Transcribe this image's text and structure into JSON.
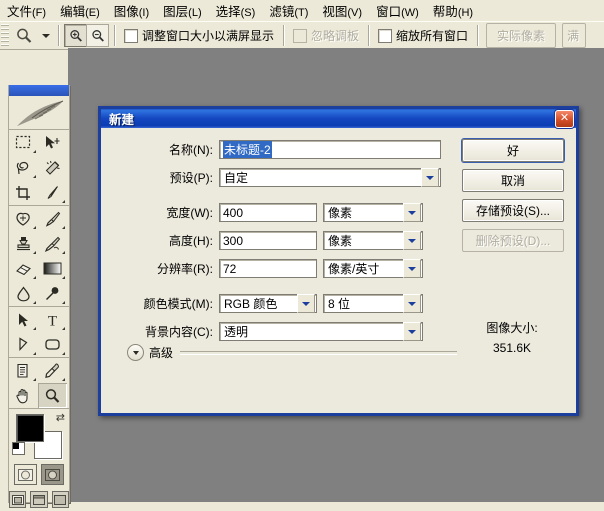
{
  "menubar": {
    "items": [
      {
        "label": "文件",
        "mnemonic": "(F)"
      },
      {
        "label": "编辑",
        "mnemonic": "(E)"
      },
      {
        "label": "图像",
        "mnemonic": "(I)"
      },
      {
        "label": "图层",
        "mnemonic": "(L)"
      },
      {
        "label": "选择",
        "mnemonic": "(S)"
      },
      {
        "label": "滤镜",
        "mnemonic": "(T)"
      },
      {
        "label": "视图",
        "mnemonic": "(V)"
      },
      {
        "label": "窗口",
        "mnemonic": "(W)"
      },
      {
        "label": "帮助",
        "mnemonic": "(H)"
      }
    ]
  },
  "options_bar": {
    "tool_icon": "zoom-tool-icon",
    "preset_dropdown_icon": "chevron-down-icon",
    "zoom_in_icon": "zoom-in-icon",
    "zoom_out_icon": "zoom-out-icon",
    "fit_window_checkbox": {
      "label": "调整窗口大小以满屏显示",
      "checked": false
    },
    "ignore_palettes_checkbox": {
      "label": "忽略调板",
      "checked": false,
      "disabled": true
    },
    "zoom_all_windows_checkbox": {
      "label": "缩放所有窗口",
      "checked": false
    },
    "actual_pixels_button": {
      "label": "实际像素",
      "disabled": true
    },
    "fit_screen_button": {
      "label": "满",
      "disabled": true
    }
  },
  "toolbox": {
    "logo_icon": "feather-logo-icon",
    "tools": [
      [
        {
          "name": "marquee-tool",
          "icon": "rect-marquee-icon",
          "selected": false,
          "has_flyout": true
        },
        {
          "name": "move-tool",
          "icon": "move-arrow-icon",
          "selected": false,
          "has_flyout": false
        },
        {
          "name": "lasso-tool",
          "icon": "lasso-icon",
          "selected": false,
          "has_flyout": true
        },
        {
          "name": "magic-wand-tool",
          "icon": "magic-wand-icon",
          "selected": false,
          "has_flyout": false
        },
        {
          "name": "crop-tool",
          "icon": "crop-icon",
          "selected": false,
          "has_flyout": false
        },
        {
          "name": "slice-tool",
          "icon": "slice-knife-icon",
          "selected": false,
          "has_flyout": true
        }
      ],
      [
        {
          "name": "healing-brush-tool",
          "icon": "healing-patch-icon",
          "selected": false,
          "has_flyout": true
        },
        {
          "name": "brush-tool",
          "icon": "paintbrush-icon",
          "selected": false,
          "has_flyout": true
        },
        {
          "name": "clone-stamp-tool",
          "icon": "stamp-icon",
          "selected": false,
          "has_flyout": true
        },
        {
          "name": "history-brush-tool",
          "icon": "history-brush-icon",
          "selected": false,
          "has_flyout": true
        },
        {
          "name": "eraser-tool",
          "icon": "eraser-icon",
          "selected": false,
          "has_flyout": true
        },
        {
          "name": "gradient-tool",
          "icon": "gradient-icon",
          "selected": false,
          "has_flyout": true
        },
        {
          "name": "blur-tool",
          "icon": "waterdrop-icon",
          "selected": false,
          "has_flyout": true
        },
        {
          "name": "dodge-tool",
          "icon": "dodge-burn-icon",
          "selected": false,
          "has_flyout": true
        }
      ],
      [
        {
          "name": "path-selection-tool",
          "icon": "black-arrow-icon",
          "selected": false,
          "has_flyout": true
        },
        {
          "name": "type-tool",
          "icon": "text-T-icon",
          "selected": false,
          "has_flyout": true
        },
        {
          "name": "pen-tool",
          "icon": "pen-nib-icon",
          "selected": false,
          "has_flyout": true
        },
        {
          "name": "shape-tool",
          "icon": "rounded-rect-icon",
          "selected": false,
          "has_flyout": true
        }
      ],
      [
        {
          "name": "notes-tool",
          "icon": "notes-icon",
          "selected": false,
          "has_flyout": true
        },
        {
          "name": "eyedropper-tool",
          "icon": "eyedropper-icon",
          "selected": false,
          "has_flyout": true
        },
        {
          "name": "hand-tool",
          "icon": "hand-icon",
          "selected": false,
          "has_flyout": false
        },
        {
          "name": "zoom-tool",
          "icon": "magnifier-icon",
          "selected": true,
          "has_flyout": false
        }
      ]
    ],
    "colors": {
      "foreground": "#000000",
      "background": "#ffffff",
      "swap_icon": "swap-colors-icon",
      "default_icon": "default-colors-icon"
    },
    "mask_modes": [
      {
        "name": "standard-mask-mode",
        "selected": true
      },
      {
        "name": "quick-mask-mode",
        "selected": false
      }
    ],
    "screen_modes": [
      {
        "name": "standard-screen-mode",
        "selected": true
      },
      {
        "name": "full-screen-menubar-mode",
        "selected": false
      },
      {
        "name": "full-screen-mode",
        "selected": false
      }
    ]
  },
  "dialog": {
    "title": "新建",
    "close_icon": "close-x-icon",
    "fields": {
      "name": {
        "label": "名称(N):",
        "value": "未标题-2",
        "selected": true
      },
      "preset": {
        "label": "预设(P):",
        "value": "自定"
      },
      "width": {
        "label": "宽度(W):",
        "value": "400",
        "unit": "像素"
      },
      "height": {
        "label": "高度(H):",
        "value": "300",
        "unit": "像素"
      },
      "resolution": {
        "label": "分辨率(R):",
        "value": "72",
        "unit": "像素/英寸"
      },
      "color_mode": {
        "label": "颜色模式(M):",
        "value": "RGB 颜色",
        "depth": "8 位"
      },
      "background_contents": {
        "label": "背景内容(C):",
        "value": "透明"
      }
    },
    "buttons": {
      "ok": {
        "label": "好",
        "default": true
      },
      "cancel": {
        "label": "取消"
      },
      "save_preset": {
        "label": "存储预设(S)..."
      },
      "delete_preset": {
        "label": "删除预设(D)...",
        "disabled": true
      }
    },
    "image_size": {
      "label": "图像大小:",
      "value": "351.6K"
    },
    "advanced": {
      "label": "高级",
      "expander_icon": "chevron-down-icon",
      "expanded": false
    }
  },
  "colors": {
    "titlebar_blue": "#1346c0",
    "dialog_bg": "#ece9dd",
    "canvas_gray": "#808080",
    "chrome_bg": "#ece9d8",
    "selection_blue": "#316ac5"
  }
}
